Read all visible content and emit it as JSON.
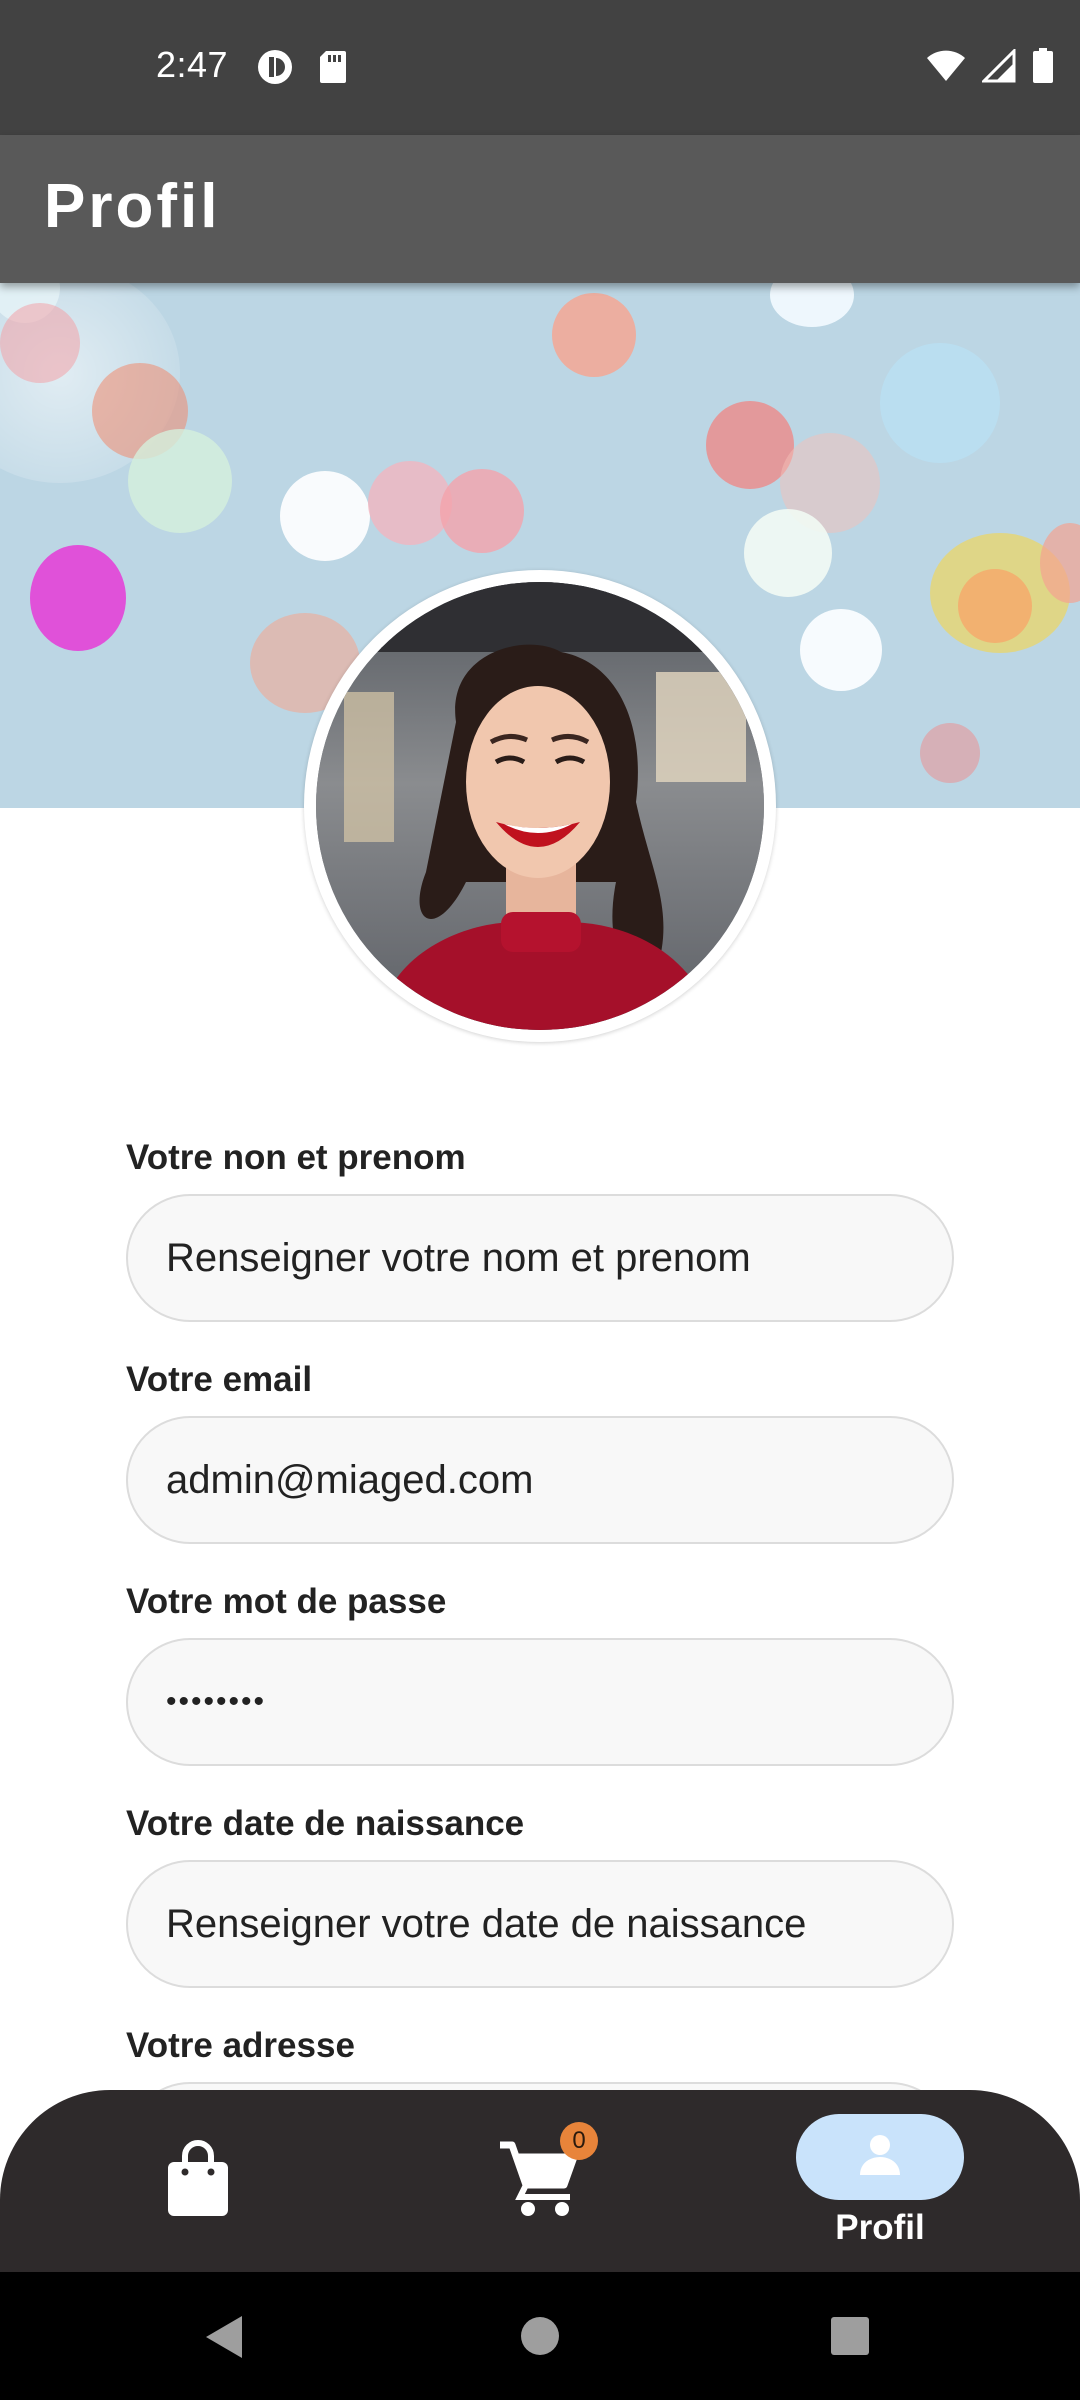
{
  "status_bar": {
    "time": "2:47",
    "icons_left": [
      "app-notification-icon",
      "sd-card-icon"
    ],
    "icons_right": [
      "wifi-icon",
      "signal-icon",
      "battery-icon"
    ]
  },
  "app_bar": {
    "title": "Profil"
  },
  "form": {
    "fields": [
      {
        "label": "Votre non et prenom",
        "value": "",
        "placeholder": "Renseigner votre nom et prenom"
      },
      {
        "label": "Votre email",
        "value": "admin@miaged.com",
        "placeholder": ""
      },
      {
        "label": "Votre mot de passe",
        "value": "••••••••",
        "placeholder": ""
      },
      {
        "label": "Votre date de naissance",
        "value": "",
        "placeholder": "Renseigner votre date de naissance"
      },
      {
        "label": "Votre adresse",
        "value": "",
        "placeholder": ""
      }
    ]
  },
  "bottom_nav": {
    "items": [
      {
        "icon": "shopping-bag-icon",
        "label": ""
      },
      {
        "icon": "shopping-cart-icon",
        "label": "",
        "badge": "0"
      },
      {
        "icon": "person-icon",
        "label": "Profil",
        "selected": true
      }
    ]
  },
  "colors": {
    "status_bar": "#424242",
    "app_bar": "#595959",
    "nav_bar": "#2e2a2b",
    "selected_pill": "#c9e3fb",
    "badge": "#e8843a"
  }
}
